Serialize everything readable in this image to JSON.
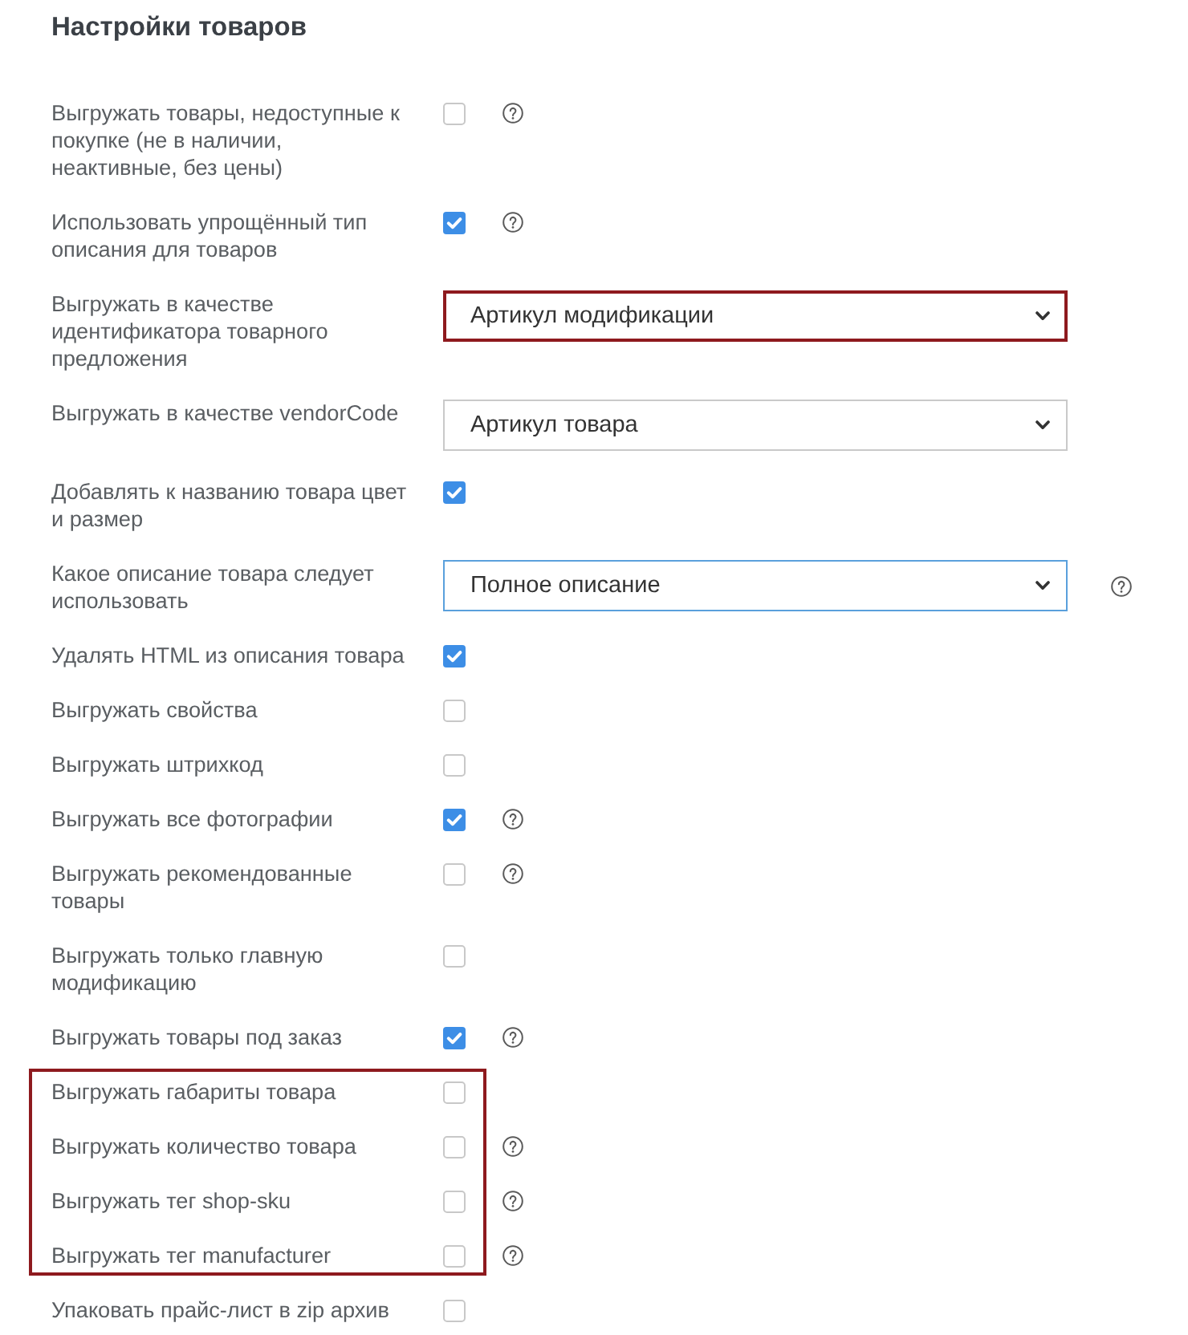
{
  "title": "Настройки товаров",
  "groups": [
    {
      "highlighted": false,
      "rows": [
        {
          "kind": "checkbox",
          "label": "Выгружать товары, недоступные к покупке (не в наличии, неактивные, без цены)",
          "checked": false,
          "help": true
        },
        {
          "kind": "checkbox",
          "label": "Использовать упрощённый тип описания для товаров",
          "checked": true,
          "help": true
        },
        {
          "kind": "select",
          "label": "Выгружать в качестве идентификатора товарного предложения",
          "value": "Артикул модификации",
          "highlighted": true,
          "focused": false,
          "help": false
        },
        {
          "kind": "select",
          "label": "Выгружать в качестве vendorCode",
          "value": "Артикул товара",
          "highlighted": false,
          "focused": false,
          "help": false
        },
        {
          "kind": "checkbox",
          "label": "Добавлять к названию товара цвет и размер",
          "checked": true,
          "help": false
        },
        {
          "kind": "select",
          "label": "Какое описание товара следует использовать",
          "value": "Полное описание",
          "highlighted": false,
          "focused": true,
          "help": true
        },
        {
          "kind": "checkbox",
          "label": "Удалять HTML из описания товара",
          "checked": true,
          "help": false
        },
        {
          "kind": "checkbox",
          "label": "Выгружать свойства",
          "checked": false,
          "help": false
        },
        {
          "kind": "checkbox",
          "label": "Выгружать штрихкод",
          "checked": false,
          "help": false
        },
        {
          "kind": "checkbox",
          "label": "Выгружать все фотографии",
          "checked": true,
          "help": true
        },
        {
          "kind": "checkbox",
          "label": "Выгружать рекомендованные товары",
          "checked": false,
          "help": true
        },
        {
          "kind": "checkbox",
          "label": "Выгружать только главную модификацию",
          "checked": false,
          "help": false
        },
        {
          "kind": "checkbox",
          "label": "Выгружать товары под заказ",
          "checked": true,
          "help": true
        }
      ]
    },
    {
      "highlighted": true,
      "rows": [
        {
          "kind": "checkbox",
          "label": "Выгружать габариты товара",
          "checked": false,
          "help": false
        },
        {
          "kind": "checkbox",
          "label": "Выгружать количество товара",
          "checked": false,
          "help": true
        },
        {
          "kind": "checkbox",
          "label": "Выгружать тег shop-sku",
          "checked": false,
          "help": true
        },
        {
          "kind": "checkbox",
          "label": "Выгружать тег manufacturer",
          "checked": false,
          "help": true
        }
      ]
    },
    {
      "highlighted": false,
      "rows": [
        {
          "kind": "checkbox",
          "label": "Упаковать прайс-лист в zip архив",
          "checked": false,
          "help": false
        }
      ]
    }
  ]
}
